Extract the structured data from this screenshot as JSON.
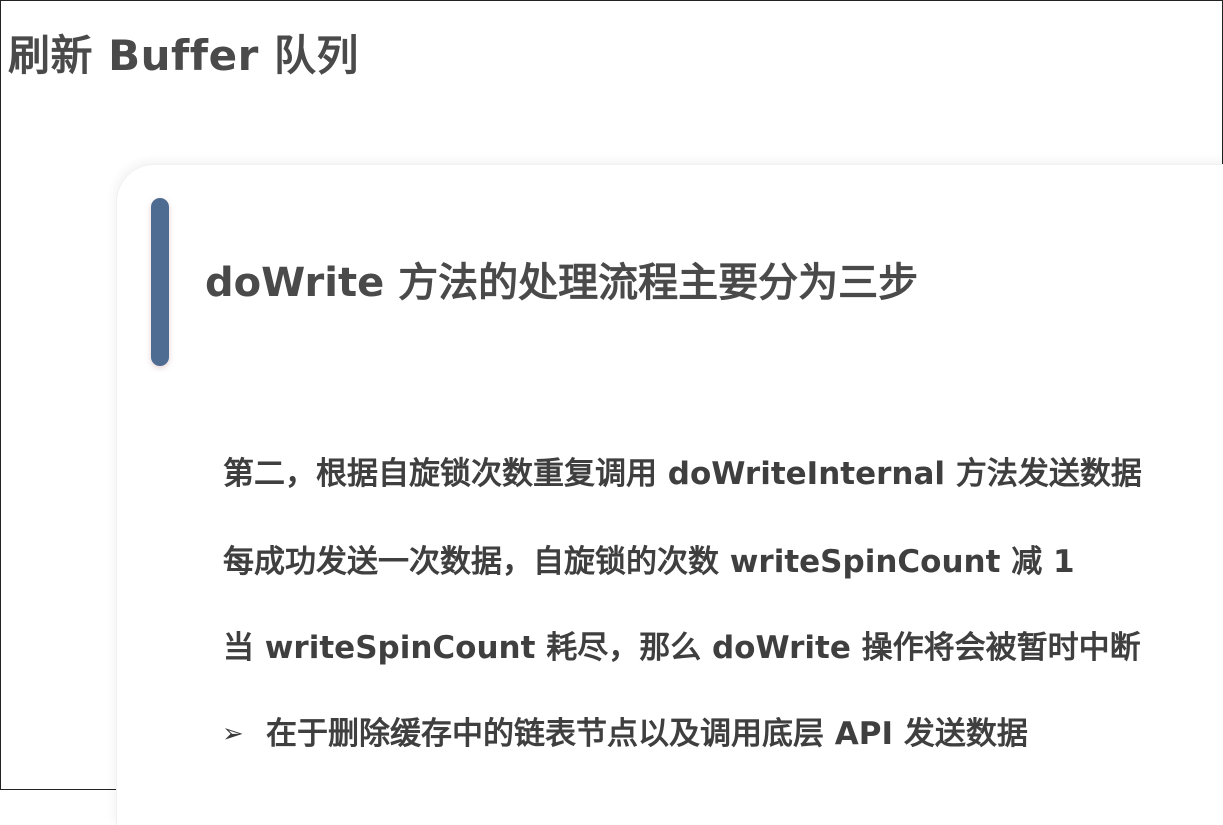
{
  "page": {
    "title": "刷新 Buffer 队列"
  },
  "card": {
    "heading": "doWrite 方法的处理流程主要分为三步",
    "lines": [
      "第二，根据自旋锁次数重复调用 doWriteInternal 方法发送数据",
      "每成功发送一次数据，自旋锁的次数 writeSpinCount 减 1",
      "当 writeSpinCount 耗尽，那么 doWrite 操作将会被暂时中断"
    ],
    "bullet": {
      "icon": "arrowhead-bullet-icon",
      "glyph": "➢",
      "text": "在于删除缓存中的链表节点以及调用底层 API 发送数据"
    }
  },
  "colors": {
    "accent_bar": "#4e6b92",
    "title_text": "#4a4a4a",
    "body_text": "#3f3f3f"
  }
}
